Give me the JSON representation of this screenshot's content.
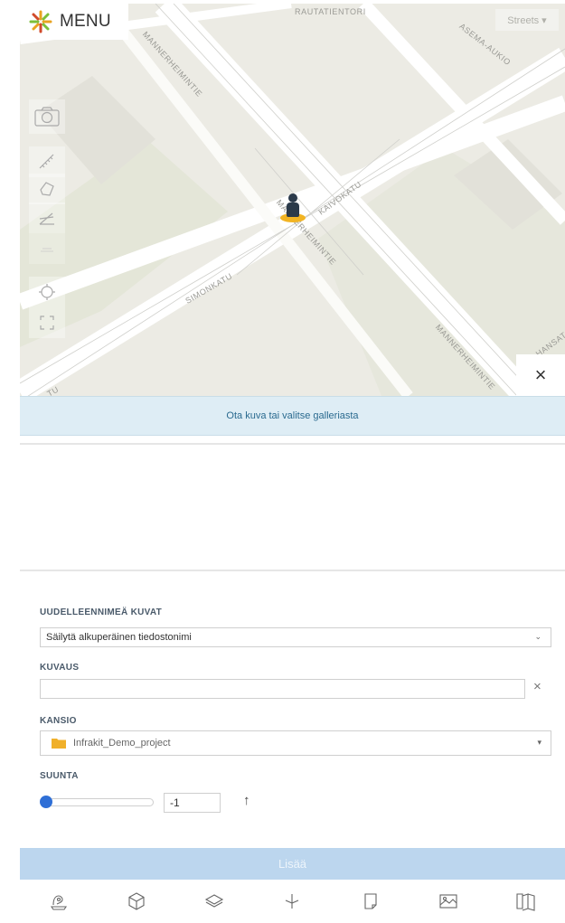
{
  "menu": {
    "label": "MENU",
    "icon": "snowflake-logo-icon"
  },
  "map": {
    "layer_selector": "Streets ▾",
    "street_labels": {
      "rautatientori": "RAUTATIENTORI",
      "mannerheimintie_top": "MANNERHEIMINTIE",
      "asema_aukio": "ASEMA-AUKIO",
      "kaivokatu": "KAIVOKATU",
      "mannerheimintie_mid": "MANNERHEIMINTIE",
      "simonkatu": "SIMONKATU",
      "mannerheimintie_bottom": "MANNERHEIMINTIE",
      "hansa": "HANSAT",
      "katu_bl": "TU"
    },
    "close_label": "×",
    "colors": {
      "background": "#ecebe4",
      "road": "#ffffff",
      "park": "#dfe3cf",
      "marker": "#f2b423"
    }
  },
  "info_bar": {
    "text": "Ota kuva tai valitse galleriasta"
  },
  "form": {
    "rename": {
      "label": "UUDELLEENNIMEÄ KUVAT",
      "selected": "Säilytä alkuperäinen tiedostonimi"
    },
    "description": {
      "label": "KUVAUS",
      "value": "",
      "clear": "×"
    },
    "folder": {
      "label": "KANSIO",
      "selected": "Infrakit_Demo_project"
    },
    "direction": {
      "label": "SUUNTA",
      "value": "-1",
      "arrow": "↑"
    },
    "submit_label": "Lisää"
  },
  "bottom_nav": [
    {
      "name": "survey-icon"
    },
    {
      "name": "cube-icon"
    },
    {
      "name": "layers-icon"
    },
    {
      "name": "measure-icon"
    },
    {
      "name": "note-icon"
    },
    {
      "name": "image-icon"
    },
    {
      "name": "map-book-icon"
    }
  ],
  "colors": {
    "accent": "#2f6fd6",
    "info_bg": "#deedf5",
    "submit_bg": "#bcd6ee"
  }
}
